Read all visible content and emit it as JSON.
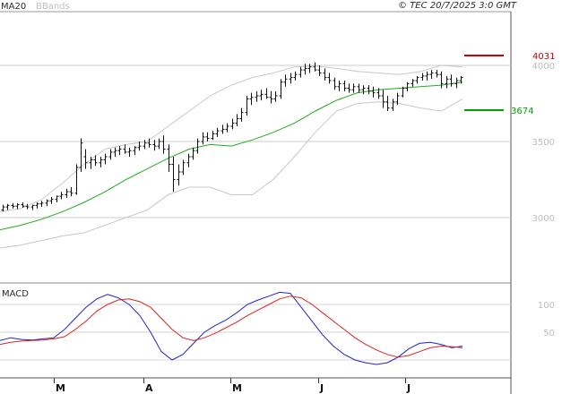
{
  "header": {
    "legend_ma": "MA20",
    "legend_bbands": "BBands",
    "source": "© TEC 20/7/2025 3:0 GMT",
    "macd_label": "MACD"
  },
  "colors": {
    "ma20": "#22aa22",
    "bbands": "#c8c8c8",
    "macd": "#2222cc",
    "signal": "#dd2222",
    "resistance": "#cc0000",
    "support": "#00a000",
    "candle": "#111111",
    "grid": "#cccccc"
  },
  "chart_data": [
    {
      "type": "line",
      "subtype": "ohlc",
      "x_labels": [
        "M",
        "A",
        "M",
        "J",
        "J"
      ],
      "ylim": [
        2600,
        4200
      ],
      "y_ticks": [
        3000,
        3500,
        4000
      ],
      "y_tick_labels": [
        "3000",
        "3500",
        "4000"
      ],
      "grid": true,
      "levels": [
        {
          "name": "resistance",
          "value": 4031,
          "label": "4031"
        },
        {
          "name": "support",
          "value": 3674,
          "label": "3674"
        }
      ],
      "bars": [
        [
          3050,
          3085,
          3040,
          3070
        ],
        [
          3070,
          3090,
          3050,
          3080
        ],
        [
          3080,
          3095,
          3060,
          3075
        ],
        [
          3075,
          3095,
          3055,
          3085
        ],
        [
          3085,
          3100,
          3065,
          3075
        ],
        [
          3075,
          3090,
          3055,
          3070
        ],
        [
          3070,
          3085,
          3050,
          3080
        ],
        [
          3080,
          3100,
          3060,
          3090
        ],
        [
          3090,
          3110,
          3070,
          3095
        ],
        [
          3095,
          3120,
          3075,
          3110
        ],
        [
          3110,
          3135,
          3090,
          3120
        ],
        [
          3120,
          3145,
          3100,
          3140
        ],
        [
          3140,
          3170,
          3120,
          3150
        ],
        [
          3150,
          3190,
          3130,
          3170
        ],
        [
          3170,
          3200,
          3140,
          3160
        ],
        [
          3160,
          3350,
          3150,
          3330
        ],
        [
          3330,
          3520,
          3300,
          3490
        ],
        [
          3400,
          3450,
          3320,
          3360
        ],
        [
          3360,
          3400,
          3320,
          3380
        ],
        [
          3380,
          3410,
          3340,
          3360
        ],
        [
          3360,
          3400,
          3330,
          3380
        ],
        [
          3380,
          3420,
          3350,
          3400
        ],
        [
          3400,
          3450,
          3380,
          3430
        ],
        [
          3430,
          3460,
          3400,
          3440
        ],
        [
          3440,
          3470,
          3410,
          3450
        ],
        [
          3450,
          3480,
          3420,
          3430
        ],
        [
          3430,
          3460,
          3400,
          3440
        ],
        [
          3440,
          3470,
          3410,
          3460
        ],
        [
          3460,
          3500,
          3440,
          3470
        ],
        [
          3470,
          3510,
          3450,
          3490
        ],
        [
          3490,
          3520,
          3460,
          3480
        ],
        [
          3480,
          3510,
          3440,
          3470
        ],
        [
          3470,
          3520,
          3450,
          3500
        ],
        [
          3500,
          3540,
          3420,
          3450
        ],
        [
          3450,
          3480,
          3300,
          3350
        ],
        [
          3350,
          3400,
          3170,
          3250
        ],
        [
          3250,
          3350,
          3210,
          3300
        ],
        [
          3300,
          3380,
          3280,
          3360
        ],
        [
          3360,
          3420,
          3330,
          3400
        ],
        [
          3400,
          3460,
          3380,
          3440
        ],
        [
          3440,
          3520,
          3420,
          3500
        ],
        [
          3500,
          3560,
          3480,
          3530
        ],
        [
          3530,
          3560,
          3500,
          3520
        ],
        [
          3520,
          3570,
          3510,
          3550
        ],
        [
          3550,
          3590,
          3530,
          3570
        ],
        [
          3570,
          3610,
          3550,
          3580
        ],
        [
          3580,
          3620,
          3560,
          3600
        ],
        [
          3600,
          3650,
          3580,
          3620
        ],
        [
          3620,
          3680,
          3600,
          3650
        ],
        [
          3650,
          3720,
          3630,
          3690
        ],
        [
          3690,
          3800,
          3670,
          3780
        ],
        [
          3780,
          3820,
          3740,
          3790
        ],
        [
          3790,
          3830,
          3760,
          3800
        ],
        [
          3800,
          3840,
          3770,
          3810
        ],
        [
          3810,
          3850,
          3780,
          3790
        ],
        [
          3790,
          3830,
          3750,
          3780
        ],
        [
          3780,
          3830,
          3760,
          3800
        ],
        [
          3800,
          3910,
          3780,
          3890
        ],
        [
          3890,
          3940,
          3860,
          3910
        ],
        [
          3910,
          3950,
          3880,
          3920
        ],
        [
          3920,
          3960,
          3900,
          3940
        ],
        [
          3940,
          3990,
          3920,
          3970
        ],
        [
          3970,
          4010,
          3940,
          3980
        ],
        [
          3980,
          4010,
          3950,
          3990
        ],
        [
          3990,
          4020,
          3960,
          3970
        ],
        [
          3970,
          4000,
          3930,
          3950
        ],
        [
          3950,
          3980,
          3900,
          3920
        ],
        [
          3920,
          3950,
          3880,
          3900
        ],
        [
          3900,
          3920,
          3840,
          3860
        ],
        [
          3860,
          3900,
          3830,
          3880
        ],
        [
          3880,
          3900,
          3830,
          3850
        ],
        [
          3850,
          3880,
          3820,
          3840
        ],
        [
          3840,
          3880,
          3820,
          3860
        ],
        [
          3860,
          3880,
          3820,
          3840
        ],
        [
          3840,
          3870,
          3810,
          3850
        ],
        [
          3850,
          3870,
          3810,
          3830
        ],
        [
          3830,
          3860,
          3790,
          3820
        ],
        [
          3820,
          3850,
          3780,
          3800
        ],
        [
          3800,
          3840,
          3720,
          3760
        ],
        [
          3760,
          3800,
          3700,
          3720
        ],
        [
          3720,
          3780,
          3700,
          3760
        ],
        [
          3760,
          3820,
          3740,
          3800
        ],
        [
          3800,
          3860,
          3790,
          3850
        ],
        [
          3850,
          3890,
          3830,
          3880
        ],
        [
          3880,
          3910,
          3860,
          3900
        ],
        [
          3900,
          3930,
          3880,
          3920
        ],
        [
          3920,
          3950,
          3900,
          3930
        ],
        [
          3930,
          3960,
          3900,
          3940
        ],
        [
          3940,
          3970,
          3910,
          3950
        ],
        [
          3950,
          3970,
          3920,
          3940
        ],
        [
          3940,
          3960,
          3850,
          3880
        ],
        [
          3880,
          3930,
          3850,
          3910
        ],
        [
          3910,
          3940,
          3860,
          3880
        ],
        [
          3880,
          3920,
          3850,
          3900
        ],
        [
          3900,
          3930,
          3880,
          3920
        ]
      ],
      "ma20": [
        2920,
        2950,
        2990,
        3040,
        3100,
        3170,
        3250,
        3320,
        3390,
        3450,
        3480,
        3470,
        3510,
        3560,
        3620,
        3700,
        3770,
        3820,
        3840,
        3850,
        3860,
        3870,
        3890
      ],
      "bb_upper": [
        3040,
        3060,
        3120,
        3230,
        3350,
        3450,
        3480,
        3500,
        3600,
        3700,
        3800,
        3870,
        3920,
        3950,
        3990,
        3995,
        3980,
        3960,
        3950,
        3940,
        3960,
        4000,
        3990
      ],
      "bb_lower": [
        2800,
        2820,
        2850,
        2880,
        2900,
        2950,
        3000,
        3050,
        3150,
        3200,
        3200,
        3150,
        3150,
        3250,
        3400,
        3560,
        3700,
        3750,
        3760,
        3750,
        3720,
        3700,
        3780
      ]
    },
    {
      "type": "line",
      "title": "MACD",
      "y_ticks": [
        100,
        50
      ],
      "y_tick_labels": [
        "100",
        "50"
      ],
      "ylim": [
        -40,
        135
      ],
      "series": [
        {
          "name": "MACD",
          "values": [
            35,
            40,
            37,
            36,
            38,
            40,
            55,
            75,
            95,
            110,
            118,
            112,
            100,
            80,
            50,
            15,
            0,
            10,
            30,
            50,
            62,
            72,
            85,
            100,
            108,
            115,
            122,
            120,
            95,
            70,
            45,
            25,
            10,
            0,
            -5,
            -8,
            -5,
            5,
            20,
            30,
            32,
            28,
            22,
            25
          ]
        },
        {
          "name": "Signal",
          "values": [
            28,
            32,
            34,
            35,
            36,
            38,
            42,
            55,
            70,
            88,
            100,
            108,
            110,
            105,
            95,
            75,
            55,
            40,
            35,
            40,
            48,
            58,
            68,
            80,
            90,
            100,
            110,
            115,
            112,
            100,
            85,
            70,
            55,
            40,
            28,
            18,
            10,
            5,
            8,
            15,
            22,
            25,
            24,
            22
          ]
        }
      ]
    }
  ]
}
